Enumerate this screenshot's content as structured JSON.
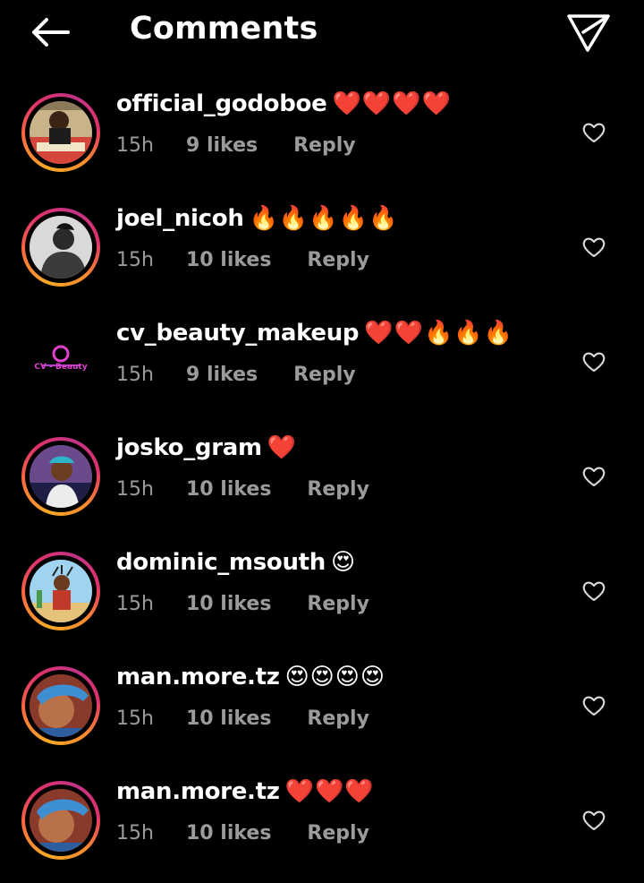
{
  "header": {
    "title": "Comments",
    "back_icon": "arrow-left-icon",
    "share_icon": "send-icon"
  },
  "comments": [
    {
      "username": "official_godoboe",
      "emojis": "❤️❤️❤️❤️",
      "time": "15h",
      "likes": "9 likes",
      "reply": "Reply"
    },
    {
      "username": "joel_nicoh",
      "emojis": "🔥🔥🔥🔥🔥",
      "time": "15h",
      "likes": "10 likes",
      "reply": "Reply"
    },
    {
      "username": "cv_beauty_makeup",
      "emojis": "❤️❤️🔥🔥🔥",
      "time": "15h",
      "likes": "9 likes",
      "reply": "Reply",
      "avatar_text": "CV - Beauty"
    },
    {
      "username": "josko_gram",
      "emojis": "❤️",
      "time": "15h",
      "likes": "10 likes",
      "reply": "Reply"
    },
    {
      "username": "dominic_msouth",
      "emojis": "😍",
      "time": "15h",
      "likes": "10 likes",
      "reply": "Reply"
    },
    {
      "username": "man.more.tz",
      "emojis": "😍😍😍😍",
      "time": "15h",
      "likes": "10 likes",
      "reply": "Reply"
    },
    {
      "username": "man.more.tz",
      "emojis": "❤️❤️❤️",
      "time": "15h",
      "likes": "10 likes",
      "reply": "Reply"
    }
  ],
  "colors": {
    "background": "#000000",
    "meta_text": "#9b9b9b",
    "ring_start": "#f9a825",
    "ring_end": "#c13584"
  }
}
